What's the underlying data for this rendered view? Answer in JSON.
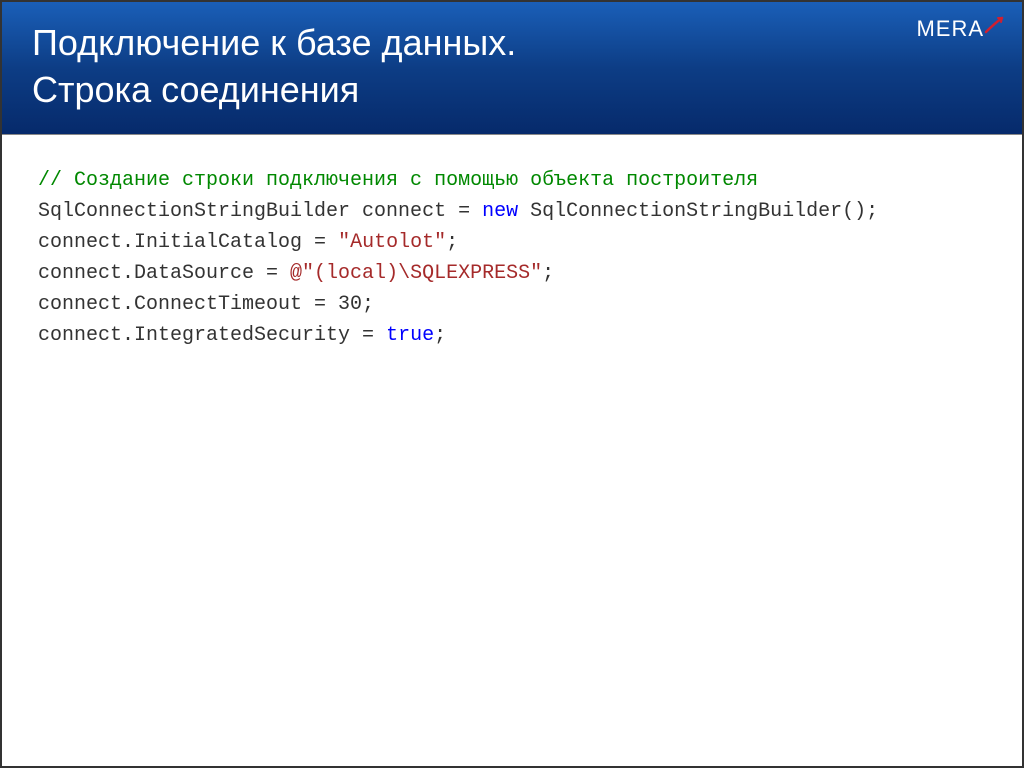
{
  "slide": {
    "title_line1": "Подключение к базе данных.",
    "title_line2": "Строка соединения",
    "logo_text": "MERA"
  },
  "code": {
    "lines": [
      [
        {
          "cls": "tok-comment",
          "text": "// Создание строки подключения с помощью объекта построителя"
        }
      ],
      [
        {
          "cls": "tok-default",
          "text": "SqlConnectionStringBuilder connect = "
        },
        {
          "cls": "tok-keyword",
          "text": "new"
        },
        {
          "cls": "tok-default",
          "text": " SqlConnectionStringBuilder();"
        }
      ],
      [
        {
          "cls": "tok-default",
          "text": "connect.InitialCatalog = "
        },
        {
          "cls": "tok-string",
          "text": "\"Autolot\""
        },
        {
          "cls": "tok-default",
          "text": ";"
        }
      ],
      [
        {
          "cls": "tok-default",
          "text": "connect.DataSource = "
        },
        {
          "cls": "tok-string",
          "text": "@\"(local)\\SQLEXPRESS\""
        },
        {
          "cls": "tok-default",
          "text": ";"
        }
      ],
      [
        {
          "cls": "tok-default",
          "text": "connect.ConnectTimeout = 30;"
        }
      ],
      [
        {
          "cls": "tok-default",
          "text": "connect.IntegratedSecurity = "
        },
        {
          "cls": "tok-keyword",
          "text": "true"
        },
        {
          "cls": "tok-default",
          "text": ";"
        }
      ]
    ]
  }
}
